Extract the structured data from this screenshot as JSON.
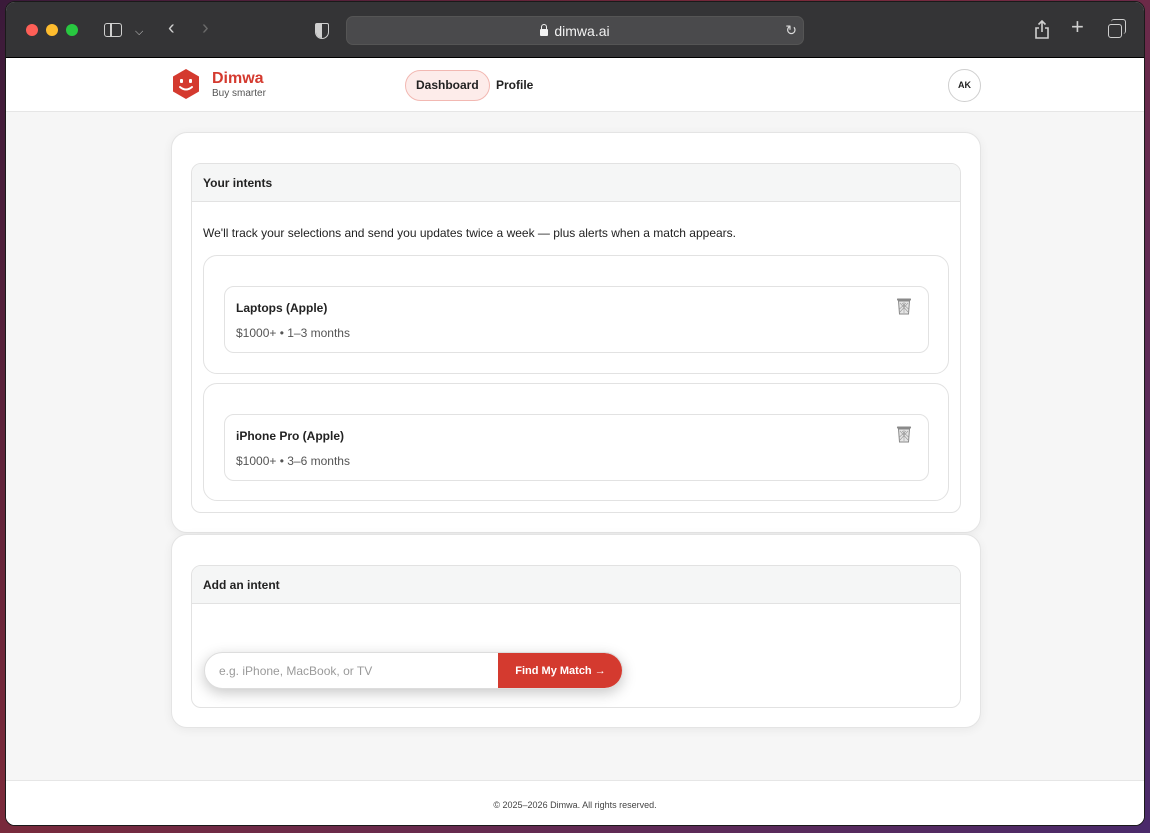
{
  "browser": {
    "url": "dimwa.ai",
    "icons": [
      "sidebar-icon",
      "chevron-down-icon",
      "back-icon",
      "forward-icon",
      "shield-icon",
      "lock-icon",
      "reload-icon",
      "share-icon",
      "plus-icon",
      "tabs-icon"
    ]
  },
  "header": {
    "brand_name": "Dimwa",
    "brand_tagline": "Buy smarter",
    "nav": {
      "dashboard": "Dashboard",
      "profile": "Profile"
    },
    "avatar_initials": "AK"
  },
  "intents_panel": {
    "title": "Your intents",
    "description": "We'll track your selections and send you updates twice a week — plus alerts when a match appears.",
    "items": [
      {
        "title": "Laptops (Apple)",
        "meta": "$1000+ • 1–3 months"
      },
      {
        "title": "iPhone Pro (Apple)",
        "meta": "$1000+ • 3–6 months"
      }
    ]
  },
  "add_panel": {
    "title": "Add an intent",
    "input_placeholder": "e.g. iPhone, MacBook, or TV",
    "button_label": "Find My Match →"
  },
  "footer": {
    "text": "© 2025–2026 Dimwa. All rights reserved."
  },
  "colors": {
    "brand": "#d43a2f",
    "nav_active_bg": "#fdecea"
  }
}
